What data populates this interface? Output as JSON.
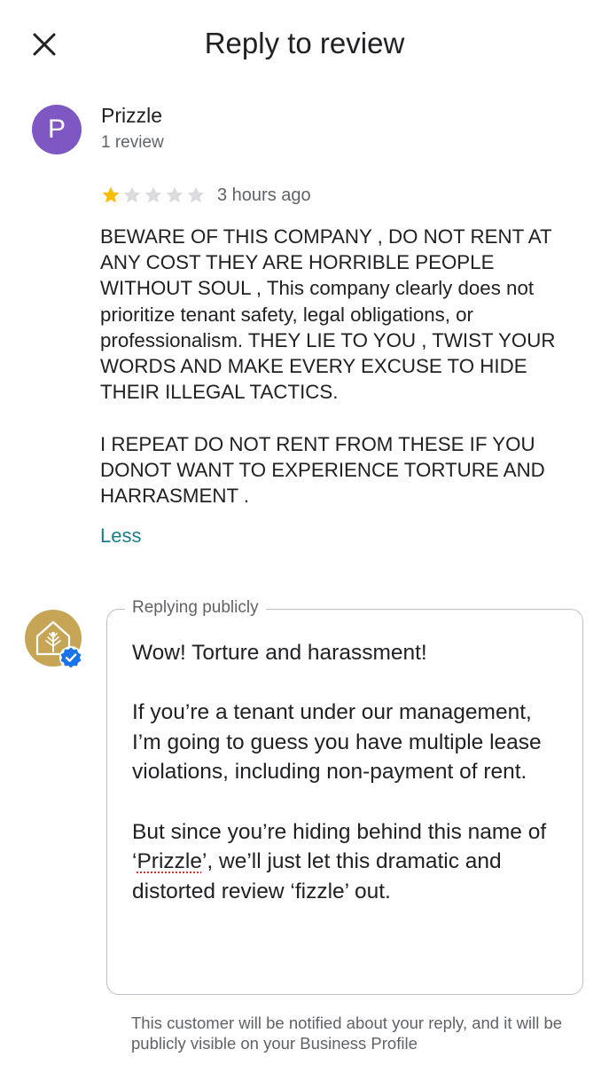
{
  "header": {
    "title": "Reply to review",
    "close_icon": "close-icon"
  },
  "reviewer": {
    "initial": "P",
    "avatar_color": "#7e57c2",
    "name": "Prizzle",
    "review_count": "1 review"
  },
  "review": {
    "rating": 1,
    "max_rating": 5,
    "star_filled_color": "#fbbc04",
    "star_empty_color": "#dadce0",
    "time_ago": "3 hours ago",
    "paragraph_1": "BEWARE OF THIS COMPANY , DO NOT RENT AT ANY COST THEY ARE HORRIBLE PEOPLE WITHOUT SOUL ,  This company clearly does not prioritize tenant safety, legal obligations, or professionalism. THEY LIE TO YOU , TWIST YOUR WORDS AND MAKE EVERY EXCUSE TO HIDE THEIR ILLEGAL TACTICS.",
    "paragraph_2": "I REPEAT DO NOT RENT FROM THESE IF YOU DONOT WANT TO EXPERIENCE TORTURE AND HARRASMENT .",
    "less_label": "Less",
    "less_color": "#1a7f8c"
  },
  "reply": {
    "business_avatar_icon": "house-tree-logo-icon",
    "verified_icon": "verified-badge-icon",
    "legend": "Replying publicly",
    "paragraph_1": "Wow! Torture and harassment!",
    "paragraph_2": "If you’re a tenant under our management, I’m going to guess you have multiple lease violations, including non-payment of rent.",
    "paragraph_3_before": "But since you’re hiding behind this name of ‘",
    "paragraph_3_flagged": "Prizzle",
    "paragraph_3_after": "’, we’ll just let this dramatic and distorted review ‘fizzle’ out."
  },
  "footer": {
    "notice": "This customer will be notified about your reply, and it will be publicly visible on your Business Profile"
  }
}
